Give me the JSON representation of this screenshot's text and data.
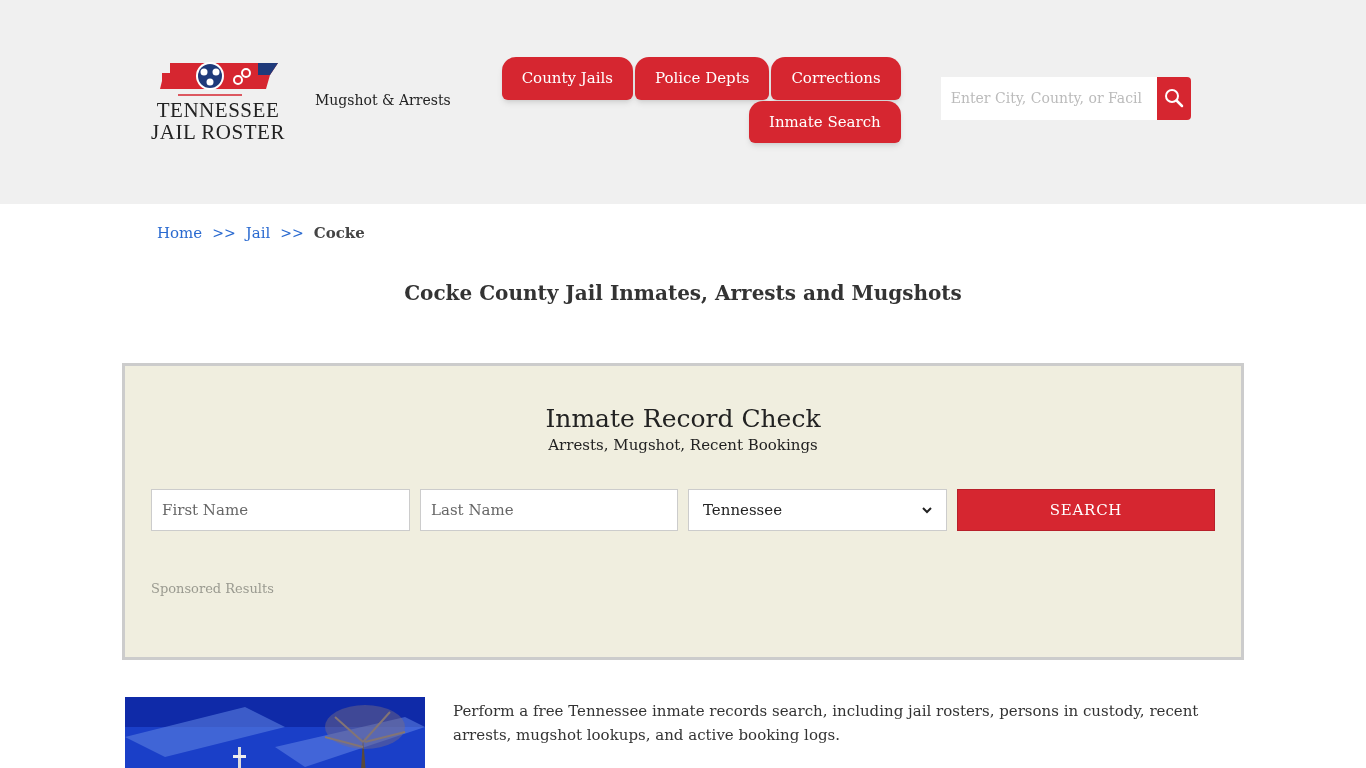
{
  "header": {
    "logo": {
      "line_1": "TENNESSEE",
      "line_2": "JAIL ROSTER"
    },
    "tagline": "Mugshot & Arrests",
    "nav": [
      {
        "label": "County Jails"
      },
      {
        "label": "Police Depts"
      },
      {
        "label": "Corrections"
      },
      {
        "label": "Inmate Search"
      }
    ],
    "search": {
      "placeholder": "Enter City, County, or Facil"
    }
  },
  "breadcrumb": [
    {
      "label": "Home",
      "kind": "link"
    },
    {
      "label": ">>",
      "kind": "separator"
    },
    {
      "label": "Jail",
      "kind": "link"
    },
    {
      "label": ">>",
      "kind": "separator"
    },
    {
      "label": "Cocke",
      "kind": "current"
    }
  ],
  "page_title": "Cocke County Jail Inmates, Arrests and Mugshots",
  "record_check": {
    "title": "Inmate Record Check",
    "subtitle": "Arrests, Mugshot, Recent Bookings",
    "first_name": {
      "placeholder": "First Name"
    },
    "last_name": {
      "placeholder": "Last Name"
    },
    "state": {
      "value": "Tennessee"
    },
    "button": "SEARCH",
    "sponsored": "Sponsored Results"
  },
  "intro": {
    "paragraph": "Perform a free Tennessee inmate records search, including jail rosters, persons in custody, recent arrests, mugshot lookups, and active booking logs."
  }
}
